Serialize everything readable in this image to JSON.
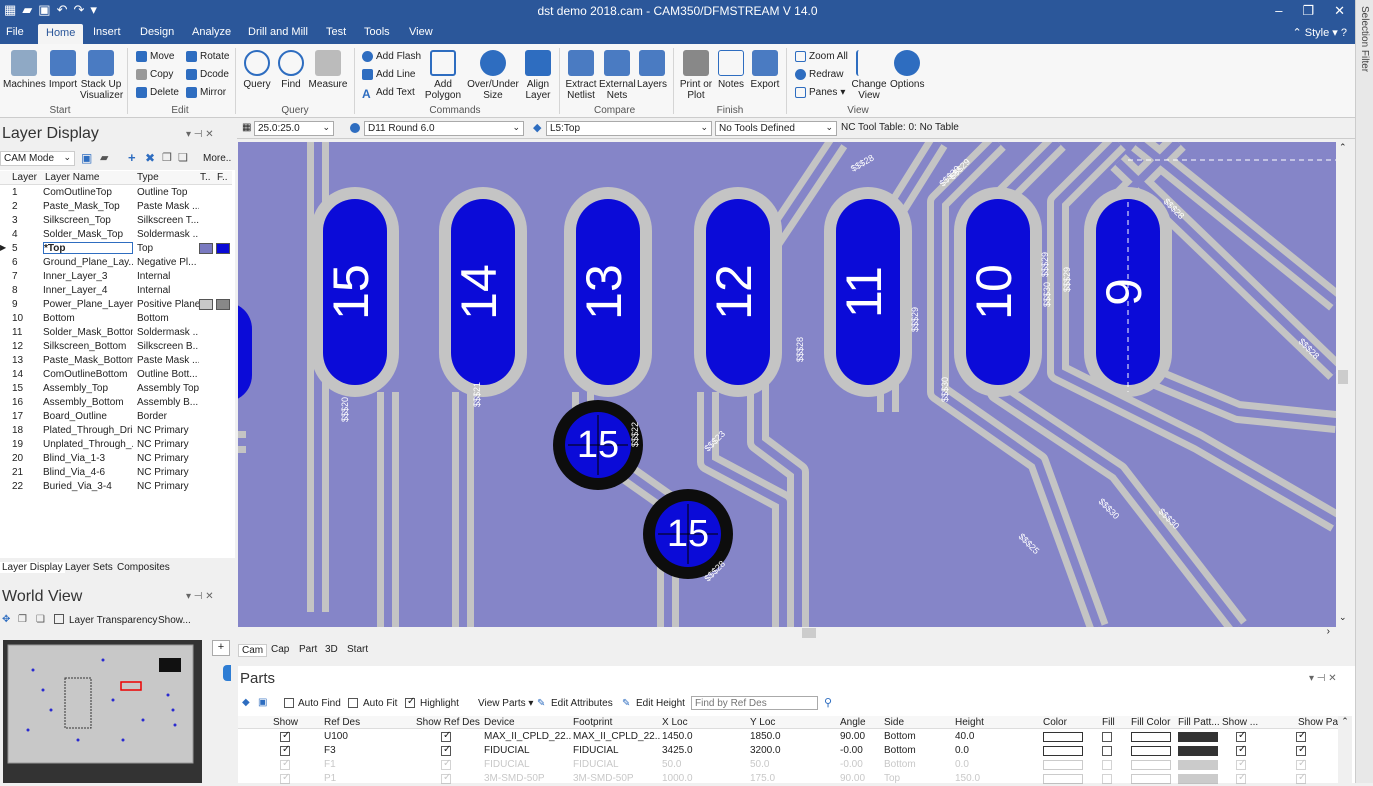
{
  "window": {
    "title": "dst demo 2018.cam - CAM350/DFMSTREAM V 14.0"
  },
  "menu": {
    "tabs": [
      "File",
      "Home",
      "Insert",
      "Design",
      "Analyze",
      "Drill and Mill",
      "Test",
      "Tools",
      "View"
    ],
    "active": "Home",
    "style_label": "Style"
  },
  "ribbon": {
    "start": {
      "group": "Start",
      "buttons": [
        "Machines",
        "Import",
        "Stack Up Visualizer"
      ]
    },
    "edit": {
      "group": "Edit",
      "items": [
        "Move",
        "Rotate",
        "Copy",
        "Dcode",
        "Delete",
        "Mirror"
      ]
    },
    "query": {
      "group": "Query",
      "buttons": [
        "Query",
        "Find",
        "Measure"
      ]
    },
    "commands": {
      "group": "Commands",
      "items": [
        "Add Flash",
        "Add Line",
        "Add Text"
      ],
      "buttons": [
        "Add Polygon",
        "Over/Under Size",
        "Align Layer"
      ]
    },
    "compare": {
      "group": "Compare",
      "buttons": [
        "Extract Netlist",
        "External Nets",
        "Layers"
      ]
    },
    "finish": {
      "group": "Finish",
      "buttons": [
        "Print or Plot",
        "Notes",
        "Export"
      ]
    },
    "view": {
      "group": "View",
      "items": [
        "Zoom All",
        "Redraw",
        "Panes"
      ],
      "buttons": [
        "Change View",
        "Options"
      ]
    }
  },
  "toolbar2": {
    "grid": "25.0:25.0",
    "dcode": "D11  Round 6.0",
    "layer": "L5:Top",
    "tools": "No Tools Defined",
    "nc_table": "NC Tool Table: 0: No Table"
  },
  "layer_display": {
    "title": "Layer Display",
    "mode": "CAM Mode",
    "more": "More..",
    "headers": [
      "Layer",
      "Layer Name",
      "Type",
      "T..",
      "F.."
    ],
    "rows": [
      [
        "1",
        "ComOutlineTop",
        "Outline Top"
      ],
      [
        "2",
        "Paste_Mask_Top",
        "Paste Mask ..."
      ],
      [
        "3",
        "Silkscreen_Top",
        "Silkscreen T..."
      ],
      [
        "4",
        "Solder_Mask_Top",
        "Soldermask ..."
      ],
      [
        "5",
        "*Top",
        "Top"
      ],
      [
        "6",
        "Ground_Plane_Lay...",
        "Negative Pl..."
      ],
      [
        "7",
        "Inner_Layer_3",
        "Internal"
      ],
      [
        "8",
        "Inner_Layer_4",
        "Internal"
      ],
      [
        "9",
        "Power_Plane_Layer...",
        "Positive Plane"
      ],
      [
        "10",
        "Bottom",
        "Bottom"
      ],
      [
        "11",
        "Solder_Mask_Bottom",
        "Soldermask ..."
      ],
      [
        "12",
        "Silkscreen_Bottom",
        "Silkscreen B..."
      ],
      [
        "13",
        "Paste_Mask_Bottom",
        "Paste Mask ..."
      ],
      [
        "14",
        "ComOutlineBottom",
        "Outline Bott..."
      ],
      [
        "15",
        "Assembly_Top",
        "Assembly Top"
      ],
      [
        "16",
        "Assembly_Bottom",
        "Assembly B..."
      ],
      [
        "17",
        "Board_Outline",
        "Border"
      ],
      [
        "18",
        "Plated_Through_Drill",
        "NC Primary"
      ],
      [
        "19",
        "Unplated_Through_...",
        "NC Primary"
      ],
      [
        "20",
        "Blind_Via_1-3",
        "NC Primary"
      ],
      [
        "21",
        "Blind_Via_4-6",
        "NC Primary"
      ],
      [
        "22",
        "Buried_Via_3-4",
        "NC Primary"
      ]
    ],
    "tabs": [
      "Layer Display",
      "Layer Sets",
      "Composites"
    ]
  },
  "world_view": {
    "title": "World View",
    "transparency": "Layer Transparency",
    "show": "Show..."
  },
  "canvas": {
    "pads": [
      "15",
      "14",
      "13",
      "12",
      "11",
      "10",
      "9"
    ],
    "vias": [
      "15",
      "15"
    ],
    "nets": [
      "$$$20",
      "$$$21",
      "$$$22",
      "$$$23",
      "$$$28",
      "$$$28",
      "$$$29",
      "$$$30",
      "$$$29",
      "$$$30",
      "$$$30",
      "$$$29",
      "$$$28",
      "$$$25",
      "$$$30",
      "$$$28",
      "$$$30",
      "$$$29",
      "$$$28"
    ],
    "tabs": [
      "Cam",
      "Cap",
      "Part",
      "3D",
      "Start"
    ]
  },
  "parts": {
    "title": "Parts",
    "auto_find": "Auto Find",
    "auto_fit": "Auto Fit",
    "highlight": "Highlight",
    "view_parts": "View Parts",
    "edit_attributes": "Edit Attributes",
    "edit_height": "Edit Height",
    "find_placeholder": "Find by Ref Des",
    "headers": [
      "Show",
      "Ref Des",
      "Show Ref Des",
      "Device",
      "Footprint",
      "X Loc",
      "Y Loc",
      "Angle",
      "Side",
      "Height",
      "Color",
      "Fill",
      "Fill Color",
      "Fill Patt...",
      "Show ...",
      "Show Pads"
    ],
    "rows": [
      [
        "U100",
        "MAX_II_CPLD_22...",
        "MAX_II_CPLD_22...",
        "1450.0",
        "1850.0",
        "90.00",
        "Bottom",
        "40.0"
      ],
      [
        "F3",
        "FIDUCIAL",
        "FIDUCIAL",
        "3425.0",
        "3200.0",
        "-0.00",
        "Bottom",
        "0.0"
      ],
      [
        "F1",
        "FIDUCIAL",
        "FIDUCIAL",
        "50.0",
        "50.0",
        "-0.00",
        "Bottom",
        "0.0"
      ],
      [
        "P1",
        "3M-SMD-50P",
        "3M-SMD-50P",
        "1000.0",
        "175.0",
        "90.00",
        "Top",
        "150.0"
      ]
    ]
  },
  "side": {
    "selection_filter": "Selection Filter"
  }
}
